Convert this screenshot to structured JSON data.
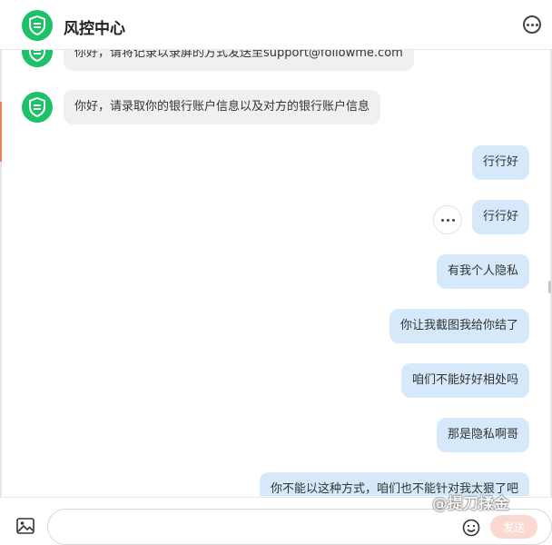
{
  "header": {
    "title": "风控中心",
    "avatar_icon": "shield-check-icon",
    "more_icon": "more-horizontal-circle-icon",
    "avatar_color": "#1ec167"
  },
  "messages": [
    {
      "side": "in",
      "text": "你好，请将记录以录屏的方式发送至support@followme.com"
    },
    {
      "side": "in",
      "text": "你好，请录取你的银行账户信息以及对方的银行账户信息"
    },
    {
      "side": "out",
      "text": "行行好"
    },
    {
      "side": "out",
      "text": "行行好"
    },
    {
      "side": "out",
      "text": "有我个人隐私"
    },
    {
      "side": "out",
      "text": "你让我截图我给你结了"
    },
    {
      "side": "out",
      "text": "咱们不能好好相处吗"
    },
    {
      "side": "out",
      "text": "那是隐私啊哥"
    },
    {
      "side": "out",
      "text": "你不能以这种方式，咱们也不能针对我太狠了吧"
    }
  ],
  "composer": {
    "image_icon": "image-icon",
    "emoji_icon": "emoji-icon",
    "send_label": "发送",
    "input_value": ""
  },
  "watermark": "@提刀揉金",
  "colors": {
    "incoming_bubble": "#f0f0f0",
    "outgoing_bubble": "#d5e9fb",
    "send_button": "#fbd8d2"
  }
}
